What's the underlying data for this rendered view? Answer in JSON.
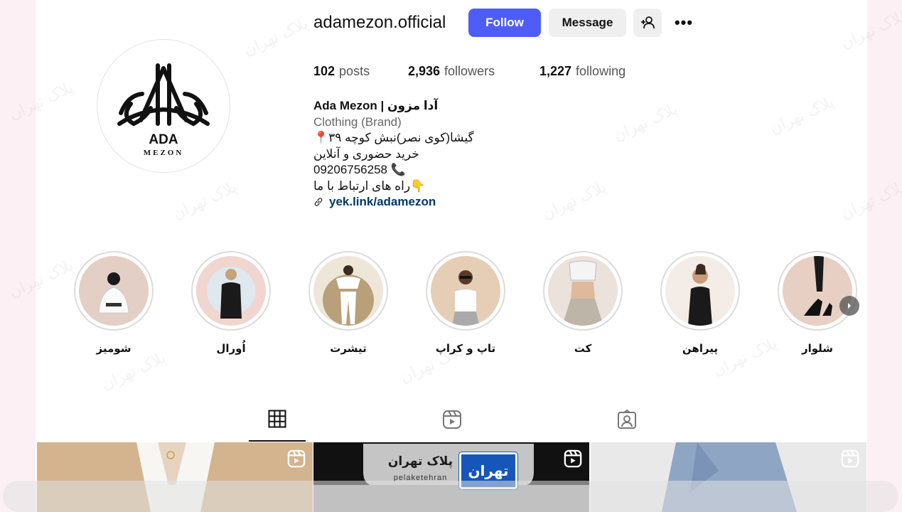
{
  "profile": {
    "username": "adamezon.official",
    "follow_label": "Follow",
    "message_label": "Message",
    "more_label": "•••",
    "stats": {
      "posts_count": "102",
      "posts_label": "posts",
      "followers_count": "2,936",
      "followers_label": "followers",
      "following_count": "1,227",
      "following_label": "following"
    },
    "bio": {
      "name": "Ada Mezon | آدا مزون",
      "category": "Clothing (Brand)",
      "line1": "📍گیشا(کوی نصر)نبش کوچه ۳۹",
      "line2": "خرید حضوری و آنلاین",
      "line3": "09206756258 📞",
      "line4": "راه های ارتباط با ما👇",
      "link": "yek.link/adamezon"
    },
    "logo": {
      "top": "ADA",
      "bottom": "MEZON"
    }
  },
  "highlights": [
    {
      "label": "شومیز",
      "bg": "#e3cfc5"
    },
    {
      "label": "اُورال",
      "bg": "#f0d6cf"
    },
    {
      "label": "تیشرت",
      "bg": "#efe6da"
    },
    {
      "label": "تاپ و کراپ",
      "bg": "#e6cdb6"
    },
    {
      "label": "کت",
      "bg": "#ebe2dc"
    },
    {
      "label": "پیراهن",
      "bg": "#f3ece7"
    },
    {
      "label": "شلوار",
      "bg": "#e8cfc4"
    }
  ],
  "tabs": [
    "posts-grid-icon",
    "reels-icon",
    "tagged-icon"
  ],
  "posts": [
    {
      "kind": "reel",
      "bg": "#c9a47a"
    },
    {
      "kind": "reel",
      "bg": "#9a9a9a",
      "sign_text": "پلاک تهران",
      "sign_sub": "pelaketehran",
      "plate_text": "تهران"
    },
    {
      "kind": "reel",
      "bg": "#c6cdd8"
    }
  ],
  "watermark_text": "پلاک تهران",
  "colors": {
    "accent": "#4f5df8",
    "link": "#00376b"
  }
}
